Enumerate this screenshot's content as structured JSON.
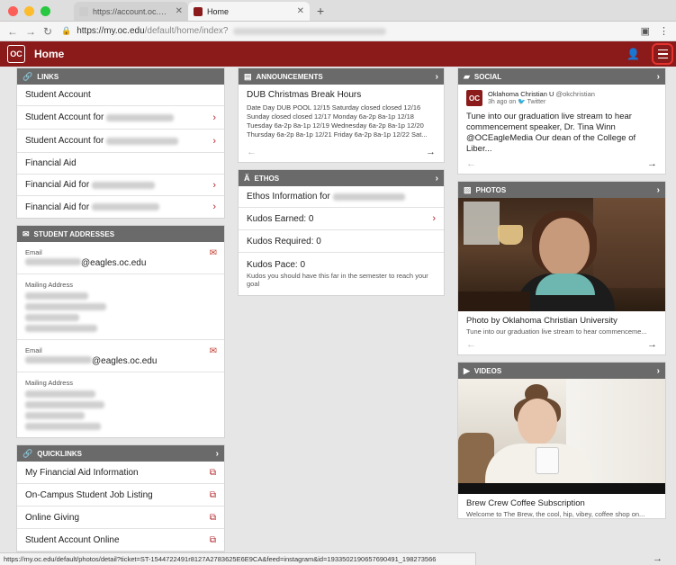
{
  "browser": {
    "tabs": [
      {
        "title": "https://account.oc.edu/impers",
        "active": false
      },
      {
        "title": "Home",
        "active": true
      }
    ],
    "new_tab": "+",
    "url_host": "https://my.oc.edu",
    "url_path": "/default/home/index?",
    "status_url": "https://my.oc.edu/default/photos/detail?ticket=ST-1544722491r8127A2783625E6E9CA&feed=instagram&id=1933502190657690491_198273566"
  },
  "site": {
    "logo_text": "OC",
    "title": "Home",
    "colors": {
      "brand": "#8b1a1a",
      "accent": "#b5262b",
      "header_gray": "#6a6a6a"
    }
  },
  "links": {
    "header": "LINKS",
    "items": [
      {
        "label": "Student Account",
        "has_chevron": false
      },
      {
        "label": "Student Account for",
        "has_chevron": true
      },
      {
        "label": "Student Account for",
        "has_chevron": true
      },
      {
        "label": "Financial Aid",
        "has_chevron": false
      },
      {
        "label": "Financial Aid for",
        "has_chevron": true
      },
      {
        "label": "Financial Aid for",
        "has_chevron": true
      }
    ]
  },
  "addresses": {
    "header": "STUDENT ADDRESSES",
    "email_label": "Email",
    "email_domain_1": "@eagles.oc.edu",
    "mailing_label": "Mailing Address",
    "email_domain_2": "@eagles.oc.edu"
  },
  "quicklinks": {
    "header": "QUICKLINKS",
    "items": [
      "My Financial Aid Information",
      "On-Campus Student Job Listing",
      "Online Giving",
      "Student Account Online"
    ]
  },
  "announcements": {
    "header": "ANNOUNCEMENTS",
    "title": "DUB Christmas Break Hours",
    "text": "Date Day DUB POOL 12/15 Saturday closed closed 12/16 Sunday closed closed 12/17 Monday 6a-2p 8a-1p 12/18 Tuesday 6a-2p 8a-1p 12/19 Wednesday 6a-2p 8a-1p 12/20 Thursday 6a-2p 8a-1p 12/21 Friday 6a-2p 8a-1p 12/22 Sat..."
  },
  "ethos": {
    "header": "ETHOS",
    "info_label": "Ethos Information for",
    "kudos_earned": "Kudos Earned: 0",
    "kudos_required": "Kudos Required: 0",
    "kudos_pace": "Kudos Pace: 0",
    "kudos_pace_note": "Kudos you should have this far in the semester to reach your goal"
  },
  "social": {
    "header": "SOCIAL",
    "author": "Oklahoma Christian U",
    "handle": "@okchristian",
    "meta": "3h ago on",
    "network": "Twitter",
    "text": "Tune into our graduation live stream to hear commencement speaker, Dr. Tina Winn @OCEagleMedia Our dean of the College of Liber..."
  },
  "photos": {
    "header": "PHOTOS",
    "caption": "Photo by Oklahoma Christian University",
    "subcaption": "Tune into our graduation live stream to hear commenceme..."
  },
  "videos": {
    "header": "VIDEOS",
    "caption": "Brew Crew Coffee Subscription",
    "subcaption": "Welcome to The Brew, the cool, hip, vibey, coffee shop on..."
  },
  "icons": {
    "back": "back-arrow-icon",
    "forward": "forward-arrow-icon",
    "reload": "reload-icon",
    "lock": "lock-icon",
    "menu": "hamburger-menu-icon",
    "user": "user-icon",
    "chevron": "chevron-right-icon",
    "external": "external-link-icon",
    "mail": "mail-icon"
  }
}
